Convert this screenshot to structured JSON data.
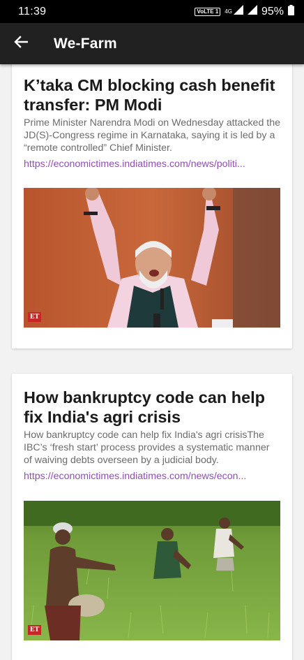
{
  "status_bar": {
    "time": "11:39",
    "volte_label": "VoLTE 1",
    "network_label": "4G",
    "battery": "95%"
  },
  "app_bar": {
    "title": "We-Farm",
    "back_icon": "arrow-back-icon"
  },
  "articles": [
    {
      "title": "K’taka CM blocking cash benefit transfer: PM Modi",
      "summary": "Prime Minister Narendra Modi on Wednesday attacked the JD(S)-Congress regime in Karnataka, saying it is led by a “remote controlled” Chief Minister.",
      "link": "https://economictimes.indiatimes.com/news/politi...",
      "image_badge": "ET"
    },
    {
      "title": "How bankruptcy code can help fix India's agri crisis",
      "summary": "How bankruptcy code can help fix India's agri crisisThe IBC’s ‘fresh start’ process provides a systematic manner of waiving debts overseen by a judicial body.",
      "link": "https://economictimes.indiatimes.com/news/econ...",
      "image_badge": "ET"
    }
  ],
  "colors": {
    "status_bar": "#000000",
    "app_bar": "#212121",
    "link": "#8e4fb5",
    "background": "#f2f2f2"
  }
}
